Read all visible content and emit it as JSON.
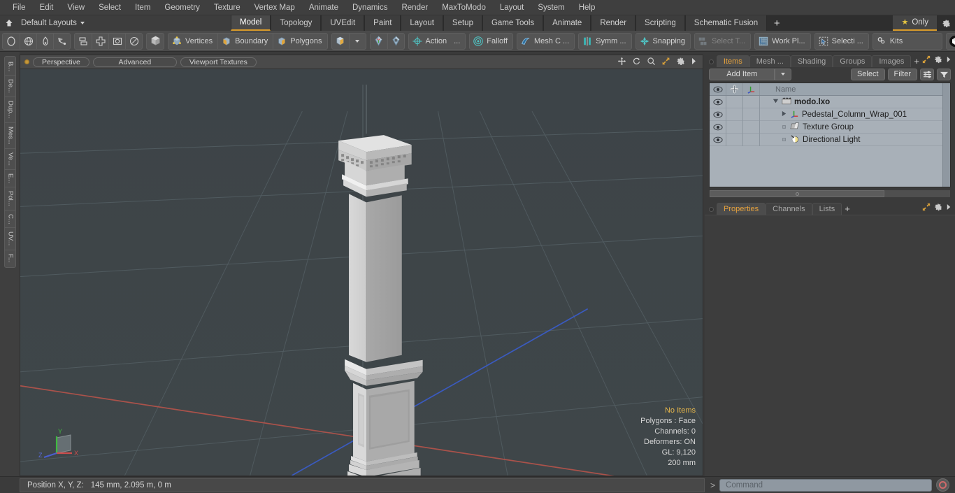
{
  "menubar": {
    "items": [
      "File",
      "Edit",
      "View",
      "Select",
      "Item",
      "Geometry",
      "Texture",
      "Vertex Map",
      "Animate",
      "Dynamics",
      "Render",
      "MaxToModo",
      "Layout",
      "System",
      "Help"
    ]
  },
  "layoutbar": {
    "home_icon": "home-icon",
    "layouts_label": "Default Layouts",
    "tabs": [
      {
        "label": "Model",
        "active": true
      },
      {
        "label": "Topology",
        "active": false
      },
      {
        "label": "UVEdit",
        "active": false
      },
      {
        "label": "Paint",
        "active": false
      },
      {
        "label": "Layout",
        "active": false
      },
      {
        "label": "Setup",
        "active": false
      },
      {
        "label": "Game Tools",
        "active": false
      },
      {
        "label": "Animate",
        "active": false
      },
      {
        "label": "Render",
        "active": false
      },
      {
        "label": "Scripting",
        "active": false
      },
      {
        "label": "Schematic Fusion",
        "active": false
      }
    ],
    "add_tab_label": "+",
    "only_label": "Only",
    "only_icon": "star-icon",
    "settings_icon": "gear-icon",
    "accent": "#d99b2b"
  },
  "toolbar": {
    "shape_tools": [
      "circle-icon",
      "sphere-icon",
      "pen-icon",
      "curve-icon"
    ],
    "arrange_tools": [
      "duplicate-icon",
      "center-icon",
      "square-outline-icon",
      "ellipse-icon"
    ],
    "mode_cube_icon": "cube-icon",
    "selection_modes": [
      {
        "label": "Vertices",
        "icon": "vertices-icon"
      },
      {
        "label": "Boundary",
        "icon": "boundary-icon"
      },
      {
        "label": "Polygons",
        "icon": "polygons-icon"
      }
    ],
    "mesh_mode_icon": "cube-shaded-icon",
    "mesh_mode_caret": "chevron-down-icon",
    "gem_tools": [
      "gem-left-icon",
      "gem-right-icon"
    ],
    "action_label": "Action",
    "action_icon": "action-center-icon",
    "action_ellipsis": "...",
    "falloff_label": "Falloff",
    "falloff_icon": "falloff-icon",
    "mesh_constraint_label": "Mesh C ...",
    "mesh_constraint_icon": "mesh-constraint-icon",
    "symmetry_label": "Symm ...",
    "symmetry_icon": "symmetry-icon",
    "snapping_label": "Snapping",
    "snapping_icon": "snapping-icon",
    "select_through_label": "Select T...",
    "select_through_icon": "select-through-icon",
    "work_plane_label": "Work Pl...",
    "work_plane_icon": "work-plane-icon",
    "selection_label": "Selecti ...",
    "selection_icon": "selection-arrow-icon",
    "kits_label": "Kits",
    "kits_icon": "gears-icon",
    "unity_icon": "unity-icon",
    "unreal_icon": "unreal-icon"
  },
  "left_tabs": {
    "items": [
      "B...",
      "De...",
      "Dup...",
      "Mes...",
      "Ve...",
      "E...",
      "Pol...",
      "C...",
      "UV...",
      "F..."
    ]
  },
  "viewport": {
    "header": {
      "dot": "viewport-indicator",
      "pills": [
        "Perspective",
        "Advanced",
        "Viewport Textures"
      ],
      "icons": [
        "move-icon",
        "rotate-icon",
        "zoom-icon",
        "fit-icon",
        "gear-icon",
        "chevron-right-icon"
      ]
    },
    "background_color": "#3f4649",
    "grid_color": "#555f63",
    "axis_x_color": "#b5544c",
    "axis_z_color": "#3a5cc6",
    "model_color": "#d4d4d4",
    "stats": {
      "no_items": "No Items",
      "polygons": "Polygons : Face",
      "channels": "Channels: 0",
      "deformers": "Deformers: ON",
      "gl": "GL: 9,120",
      "scale": "200 mm"
    },
    "gizmo": {
      "x_label": "X",
      "y_label": "Y",
      "z_label": "Z",
      "x_color": "#cc4d4d",
      "y_color": "#4fbb4f",
      "z_color": "#4a5fd0"
    }
  },
  "right_panel": {
    "tabs": [
      {
        "label": "Items",
        "active": true
      },
      {
        "label": "Mesh ...",
        "active": false
      },
      {
        "label": "Shading",
        "active": false
      },
      {
        "label": "Groups",
        "active": false
      },
      {
        "label": "Images",
        "active": false
      }
    ],
    "tab_plus": "+",
    "tab_icons": [
      "expand-icon",
      "gear-icon",
      "chevron-right-icon"
    ],
    "toolrow": {
      "add_item_label": "Add Item",
      "add_item_caret": "chevron-down-icon",
      "select_label": "Select",
      "filter_label": "Filter",
      "list_options_icon": "list-options-icon",
      "filter_funnel_icon": "funnel-icon"
    },
    "list": {
      "columns": [
        "eye-icon",
        "lock-icon",
        "axis-icon",
        "Name"
      ],
      "name_header": "Name",
      "rows": [
        {
          "name": "modo.lxo",
          "icon": "scene-icon",
          "depth": 0,
          "bold": true,
          "expander": "triangle-down-icon",
          "eye": true
        },
        {
          "name": "Pedestal_Column_Wrap_001",
          "icon": "mesh-axis-icon",
          "depth": 1,
          "bold": false,
          "expander": "triangle-right-icon",
          "eye": true
        },
        {
          "name": "Texture Group",
          "icon": "texture-group-icon",
          "depth": 1,
          "bold": false,
          "expander": "none",
          "eye": true
        },
        {
          "name": "Directional Light",
          "icon": "directional-light-icon",
          "depth": 1,
          "bold": false,
          "expander": "none",
          "eye": true
        }
      ]
    },
    "properties": {
      "tabs": [
        {
          "label": "Properties",
          "active": true
        },
        {
          "label": "Channels",
          "active": false
        },
        {
          "label": "Lists",
          "active": false
        }
      ],
      "tab_plus": "+",
      "tab_icons": [
        "expand-icon",
        "gear-icon",
        "chevron-right-icon"
      ]
    }
  },
  "statusbar": {
    "position_label": "Position X, Y, Z:",
    "position_value": "145 mm, 2.095 m, 0 m",
    "command_prompt": ">",
    "command_placeholder": "Command",
    "record_icon": "record-icon"
  }
}
